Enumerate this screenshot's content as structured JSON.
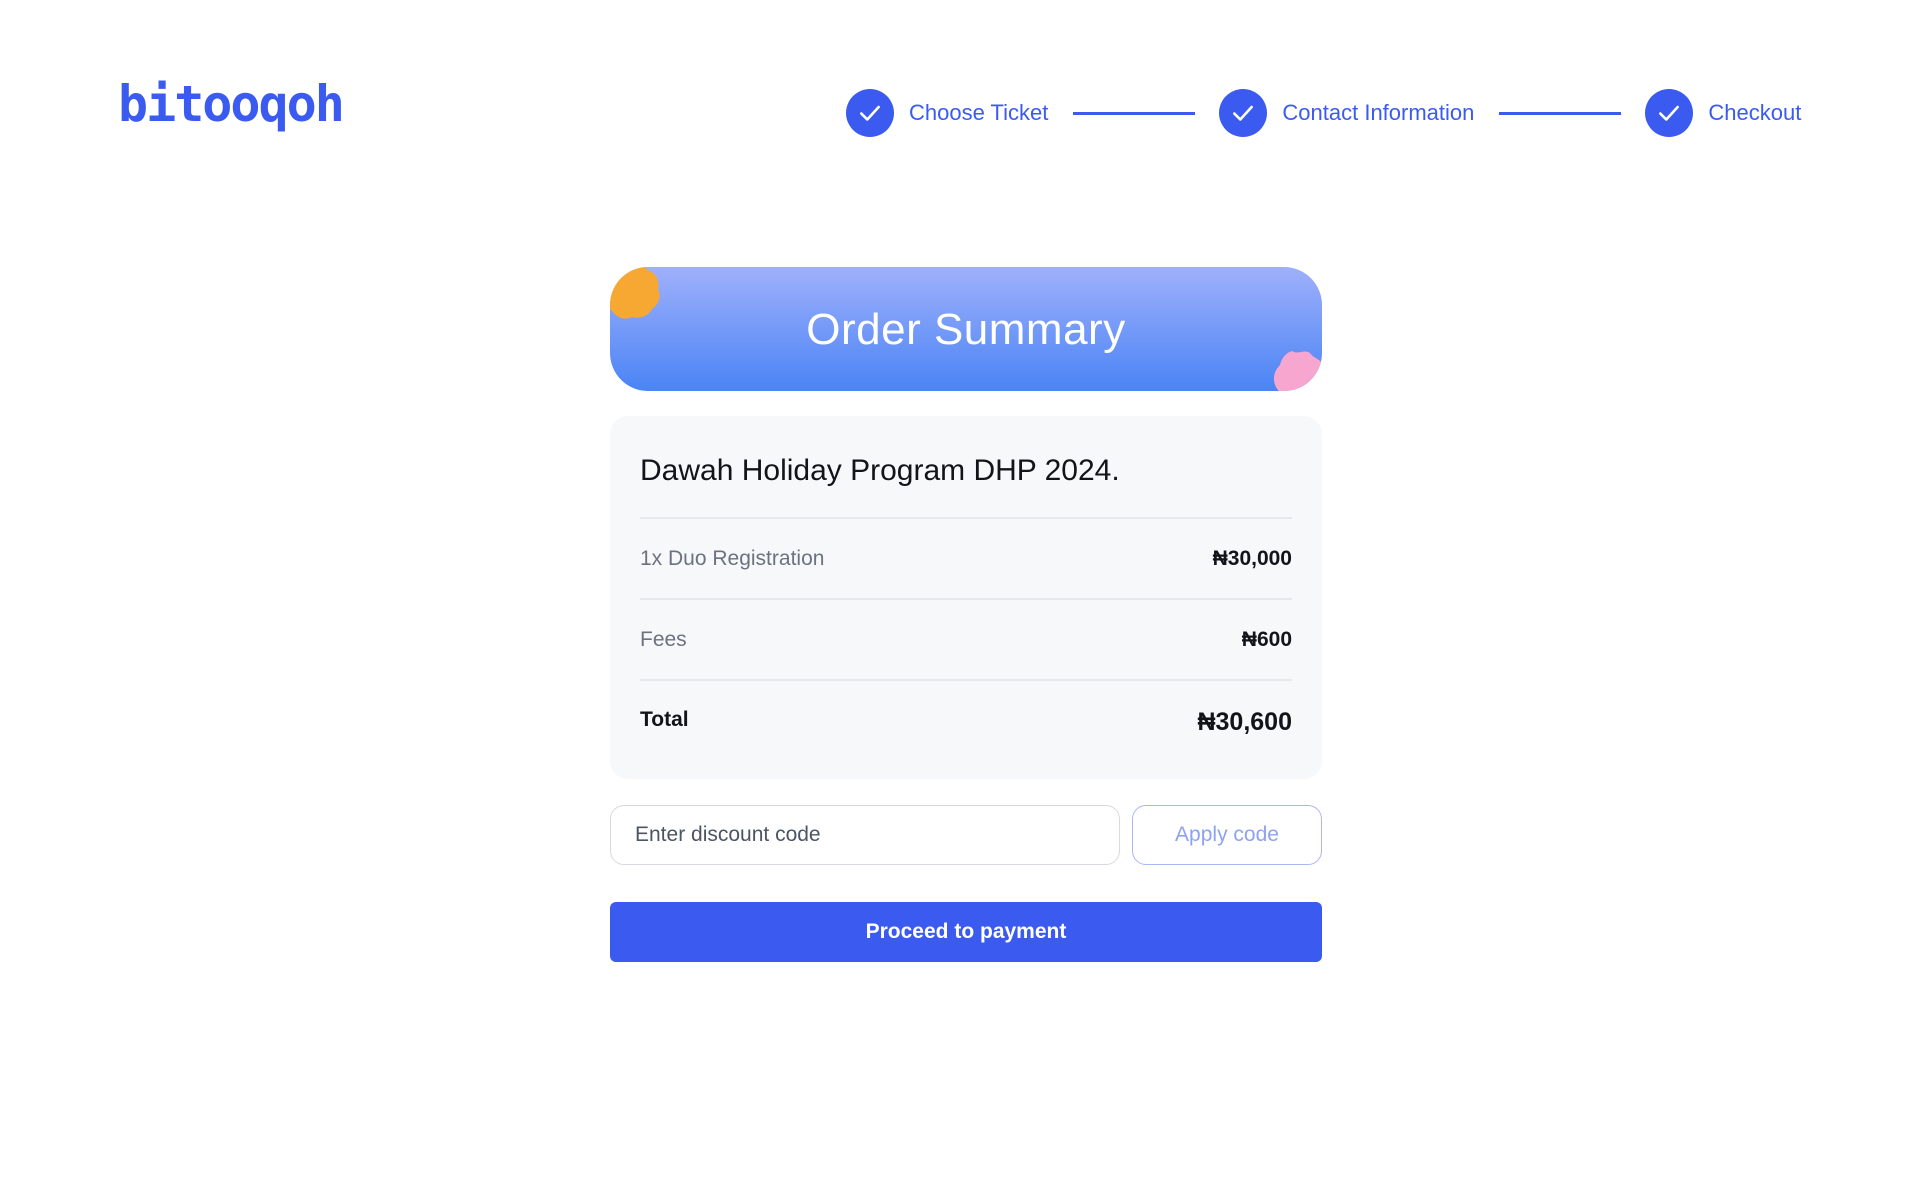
{
  "brand": {
    "logo_text": "bitooqoh",
    "color": "#3b5bf0"
  },
  "stepper": {
    "steps": [
      {
        "label": "Choose Ticket",
        "status": "complete",
        "icon": "check-icon"
      },
      {
        "label": "Contact Information",
        "status": "complete",
        "icon": "check-icon"
      },
      {
        "label": "Checkout",
        "status": "complete",
        "icon": "check-icon"
      }
    ]
  },
  "summary": {
    "title": "Order Summary",
    "event_name": "Dawah Holiday Program DHP 2024.",
    "items": [
      {
        "label": "1x Duo Registration",
        "amount": "₦30,000"
      },
      {
        "label": "Fees",
        "amount": "₦600"
      }
    ],
    "total_label": "Total",
    "total_amount": "₦30,600"
  },
  "discount": {
    "placeholder": "Enter discount code",
    "value": "",
    "apply_label": "Apply code"
  },
  "proceed_label": "Proceed to payment",
  "colors": {
    "accent": "#3b5bf0",
    "header_gradient_top": "#9fb0fb",
    "header_gradient_bottom": "#4a84f5",
    "blob_orange": "#f7a832",
    "blob_pink": "#f6a6cf"
  }
}
